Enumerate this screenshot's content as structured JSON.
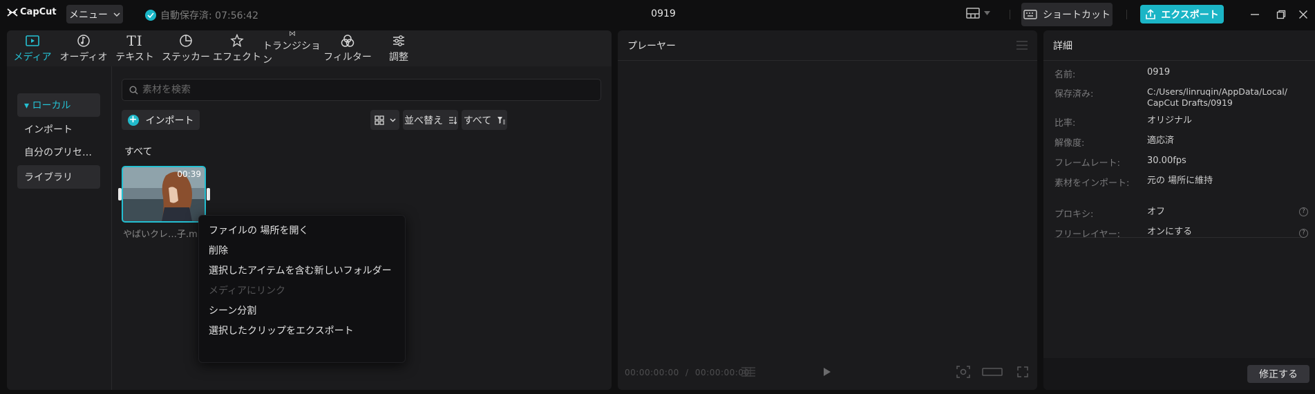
{
  "app": {
    "logo_text": "CapCut",
    "menu_label": "メニュー",
    "autosave_text": "自動保存済: 07:56:42",
    "project_title": "0919",
    "shortcut_label": "ショートカット",
    "export_label": "エクスポート",
    "accent_color": "#1bb5c6"
  },
  "tool_tabs": [
    {
      "label": "メディア",
      "icon": "media-icon",
      "active": true
    },
    {
      "label": "オーディオ",
      "icon": "audio-icon"
    },
    {
      "label": "テキスト",
      "icon": "text-icon",
      "glyph": "TI"
    },
    {
      "label": "ステッカー",
      "icon": "sticker-icon"
    },
    {
      "label": "エフェクト",
      "icon": "effect-icon"
    },
    {
      "label": "トランジション",
      "icon": "transition-icon"
    },
    {
      "label": "フィルター",
      "icon": "filter-icon"
    },
    {
      "label": "調整",
      "icon": "adjust-icon"
    }
  ],
  "media_sidebar": {
    "items": [
      {
        "label": "▾ ローカル"
      },
      {
        "label": "インポート"
      },
      {
        "label": "自分のプリセ…"
      },
      {
        "label": "ライブラリ"
      }
    ]
  },
  "media": {
    "search_placeholder": "素材を検索",
    "import_label": "インポート",
    "sort_label": "並べ替え",
    "filter_label": "すべて",
    "section_label": "すべて",
    "clip": {
      "duration": "00:39",
      "name": "やばいクレ…子.m"
    }
  },
  "context_menu": {
    "items": [
      {
        "label": "ファイルの 場所を開く",
        "disabled": false
      },
      {
        "label": "削除",
        "disabled": false
      },
      {
        "label": "選択したアイテムを含む新しいフォルダー",
        "disabled": false
      },
      {
        "label": "メディアにリンク",
        "disabled": true
      },
      {
        "label": "シーン分割",
        "disabled": false
      },
      {
        "label": "選択したクリップをエクスポート",
        "disabled": false
      }
    ]
  },
  "player": {
    "title": "プレーヤー",
    "timecode_current": "00:00:00:00",
    "timecode_sep": "/",
    "timecode_total": "00:00:00:00"
  },
  "detail": {
    "title": "詳細",
    "rows": [
      {
        "key": "名前:",
        "value": "0919"
      },
      {
        "key": "保存済み:",
        "value": "C:/Users/linruqin/AppData/Local/\nCapCut Drafts/0919"
      },
      {
        "key": "比率:",
        "value": "オリジナル"
      },
      {
        "key": "解像度:",
        "value": "適応済"
      },
      {
        "key": "フレームレート:",
        "value": "30.00fps"
      },
      {
        "key": "素材をインポート:",
        "value": "元の 場所に維持"
      },
      {
        "key": "プロキシ:",
        "value": "オフ"
      },
      {
        "key": "フリーレイヤー:",
        "value": "オンにする"
      }
    ],
    "modify_label": "修正する"
  }
}
